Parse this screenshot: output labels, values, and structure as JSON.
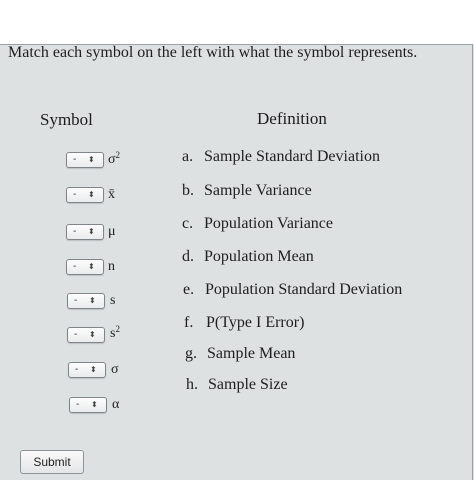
{
  "question": "Match each symbol on the left with what the symbol represents.",
  "headers": {
    "symbol": "Symbol",
    "definition": "Definition"
  },
  "rows": [
    {
      "selected": "-",
      "symbol_base": "σ",
      "symbol_sup": "2"
    },
    {
      "selected": "-",
      "symbol_base": "x̄",
      "symbol_sup": ""
    },
    {
      "selected": "-",
      "symbol_base": "μ",
      "symbol_sup": ""
    },
    {
      "selected": "-",
      "symbol_base": "n",
      "symbol_sup": ""
    },
    {
      "selected": "-",
      "symbol_base": "s",
      "symbol_sup": ""
    },
    {
      "selected": "-",
      "symbol_base": "s",
      "symbol_sup": "2"
    },
    {
      "selected": "-",
      "symbol_base": "σ",
      "symbol_sup": ""
    },
    {
      "selected": "-",
      "symbol_base": "α",
      "symbol_sup": ""
    }
  ],
  "definitions": [
    {
      "letter": "a.",
      "text": "Sample Standard Deviation"
    },
    {
      "letter": "b.",
      "text": "Sample Variance"
    },
    {
      "letter": "c.",
      "text": "Population Variance"
    },
    {
      "letter": "d.",
      "text": "Population Mean"
    },
    {
      "letter": "e.",
      "text": "Population Standard Deviation"
    },
    {
      "letter": "f.",
      "text": "P(Type I Error)"
    },
    {
      "letter": "g.",
      "text": "Sample Mean"
    },
    {
      "letter": "h.",
      "text": "Sample Size"
    }
  ],
  "submit_label": "Submit",
  "select_arrow": "⬍"
}
